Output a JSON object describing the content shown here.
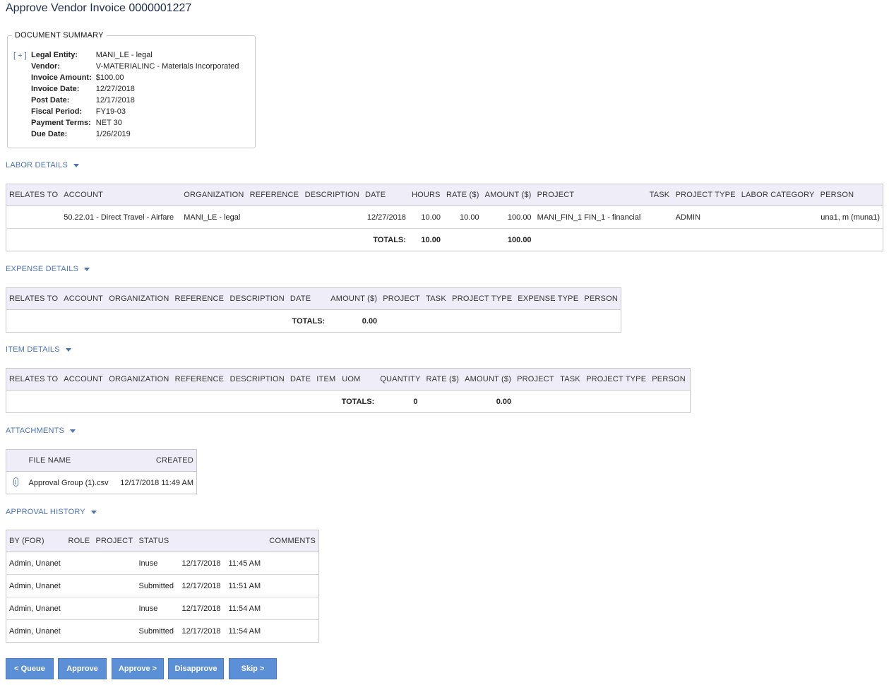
{
  "page_title": "Approve Vendor Invoice 0000001227",
  "summary": {
    "legend": "DOCUMENT SUMMARY",
    "expander": "[ + ]",
    "fields": [
      {
        "label": "Legal Entity:",
        "value": "MANI_LE - legal"
      },
      {
        "label": "Vendor:",
        "value": "V-MATERIALINC - Materials Incorporated"
      },
      {
        "label": "Invoice Amount:",
        "value": "$100.00"
      },
      {
        "label": "Invoice Date:",
        "value": "12/27/2018"
      },
      {
        "label": "Post Date:",
        "value": "12/17/2018"
      },
      {
        "label": "Fiscal Period:",
        "value": "FY19-03"
      },
      {
        "label": "Payment Terms:",
        "value": "NET 30"
      },
      {
        "label": "Due Date:",
        "value": "1/26/2019"
      }
    ]
  },
  "labor": {
    "title": "LABOR DETAILS",
    "headers": [
      "RELATES TO",
      "ACCOUNT",
      "ORGANIZATION",
      "REFERENCE",
      "DESCRIPTION",
      "DATE",
      "HOURS",
      "RATE ($)",
      "AMOUNT ($)",
      "PROJECT",
      "TASK",
      "PROJECT TYPE",
      "LABOR CATEGORY",
      "PERSON"
    ],
    "row": {
      "relates_to": "",
      "account": "50.22.01 - Direct Travel - Airfare",
      "organization": "MANI_LE - legal",
      "reference": "",
      "description": "",
      "date": "12/27/2018",
      "hours": "10.00",
      "rate": "10.00",
      "amount": "100.00",
      "project": "MANI_FIN_1 FIN_1 - financial",
      "task": "",
      "project_type": "ADMIN",
      "labor_category": "",
      "person": "una1, m (muna1)"
    },
    "totals_label": "TOTALS:",
    "total_hours": "10.00",
    "total_amount": "100.00"
  },
  "expense": {
    "title": "EXPENSE DETAILS",
    "headers": [
      "RELATES TO",
      "ACCOUNT",
      "ORGANIZATION",
      "REFERENCE",
      "DESCRIPTION",
      "DATE",
      "AMOUNT ($)",
      "PROJECT",
      "TASK",
      "PROJECT TYPE",
      "EXPENSE TYPE",
      "PERSON"
    ],
    "totals_label": "TOTALS:",
    "total_amount": "0.00"
  },
  "item": {
    "title": "ITEM DETAILS",
    "headers": [
      "RELATES TO",
      "ACCOUNT",
      "ORGANIZATION",
      "REFERENCE",
      "DESCRIPTION",
      "DATE",
      "ITEM",
      "UOM",
      "QUANTITY",
      "RATE ($)",
      "AMOUNT ($)",
      "PROJECT",
      "TASK",
      "PROJECT TYPE",
      "PERSON"
    ],
    "totals_label": "TOTALS:",
    "total_quantity": "0",
    "total_amount": "0.00"
  },
  "attachments": {
    "title": "ATTACHMENTS",
    "headers": [
      "FILE NAME",
      "CREATED"
    ],
    "rows": [
      {
        "file_name": "Approval Group (1).csv",
        "created": "12/17/2018 11:49 AM",
        "icon": "paperclip-icon"
      }
    ]
  },
  "history": {
    "title": "APPROVAL HISTORY",
    "headers": [
      "BY (FOR)",
      "ROLE",
      "PROJECT",
      "STATUS",
      "COMMENTS"
    ],
    "rows": [
      {
        "by": "Admin, Unanet",
        "role": "",
        "project": "",
        "status": "Inuse",
        "date": "12/17/2018",
        "time": "11:45 AM",
        "comments": ""
      },
      {
        "by": "Admin, Unanet",
        "role": "",
        "project": "",
        "status": "Submitted",
        "date": "12/17/2018",
        "time": "11:51 AM",
        "comments": ""
      },
      {
        "by": "Admin, Unanet",
        "role": "",
        "project": "",
        "status": "Inuse",
        "date": "12/17/2018",
        "time": "11:54 AM",
        "comments": ""
      },
      {
        "by": "Admin, Unanet",
        "role": "",
        "project": "",
        "status": "Submitted",
        "date": "12/17/2018",
        "time": "11:54 AM",
        "comments": ""
      }
    ]
  },
  "buttons": {
    "queue": "< Queue",
    "approve": "Approve",
    "approve_next": "Approve >",
    "disapprove": "Disapprove",
    "skip": "Skip >"
  },
  "colors": {
    "link": "#4a73b7",
    "button": "#5b8fd6",
    "header_bg": "#efeef8"
  }
}
